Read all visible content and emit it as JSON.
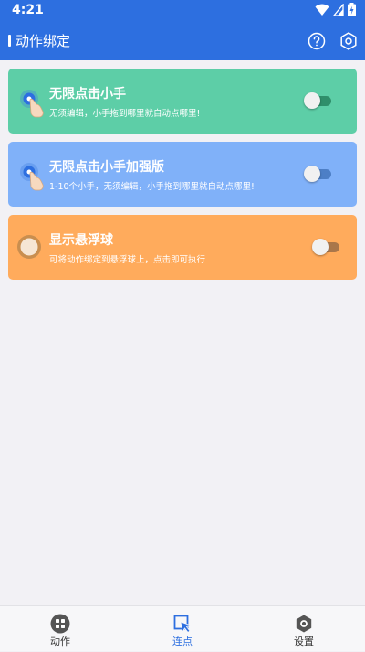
{
  "status_bar": {
    "time": "4:21"
  },
  "app_bar": {
    "title": "动作绑定"
  },
  "cards": [
    {
      "title": "无限点击小手",
      "desc": "无须编辑，小手拖到哪里就自动点哪里!",
      "toggle_on": false,
      "color": "#5dcea7"
    },
    {
      "title": "无限点击小手加强版",
      "desc": "1-10个小手，无须编辑，小手拖到哪里就自动点哪里!",
      "toggle_on": false,
      "color": "#80b1f9"
    },
    {
      "title": "显示悬浮球",
      "desc": "可将动作绑定到悬浮球上，点击即可执行",
      "toggle_on": false,
      "color": "#ffab5c"
    }
  ],
  "bottom_nav": {
    "items": [
      {
        "label": "动作",
        "icon": "grid-icon"
      },
      {
        "label": "连点",
        "icon": "cursor-click-icon",
        "active": true
      },
      {
        "label": "设置",
        "icon": "hexagon-gear-icon"
      }
    ]
  },
  "colors": {
    "primary": "#2d6fe0",
    "active_nav": "#2d6fe0"
  }
}
